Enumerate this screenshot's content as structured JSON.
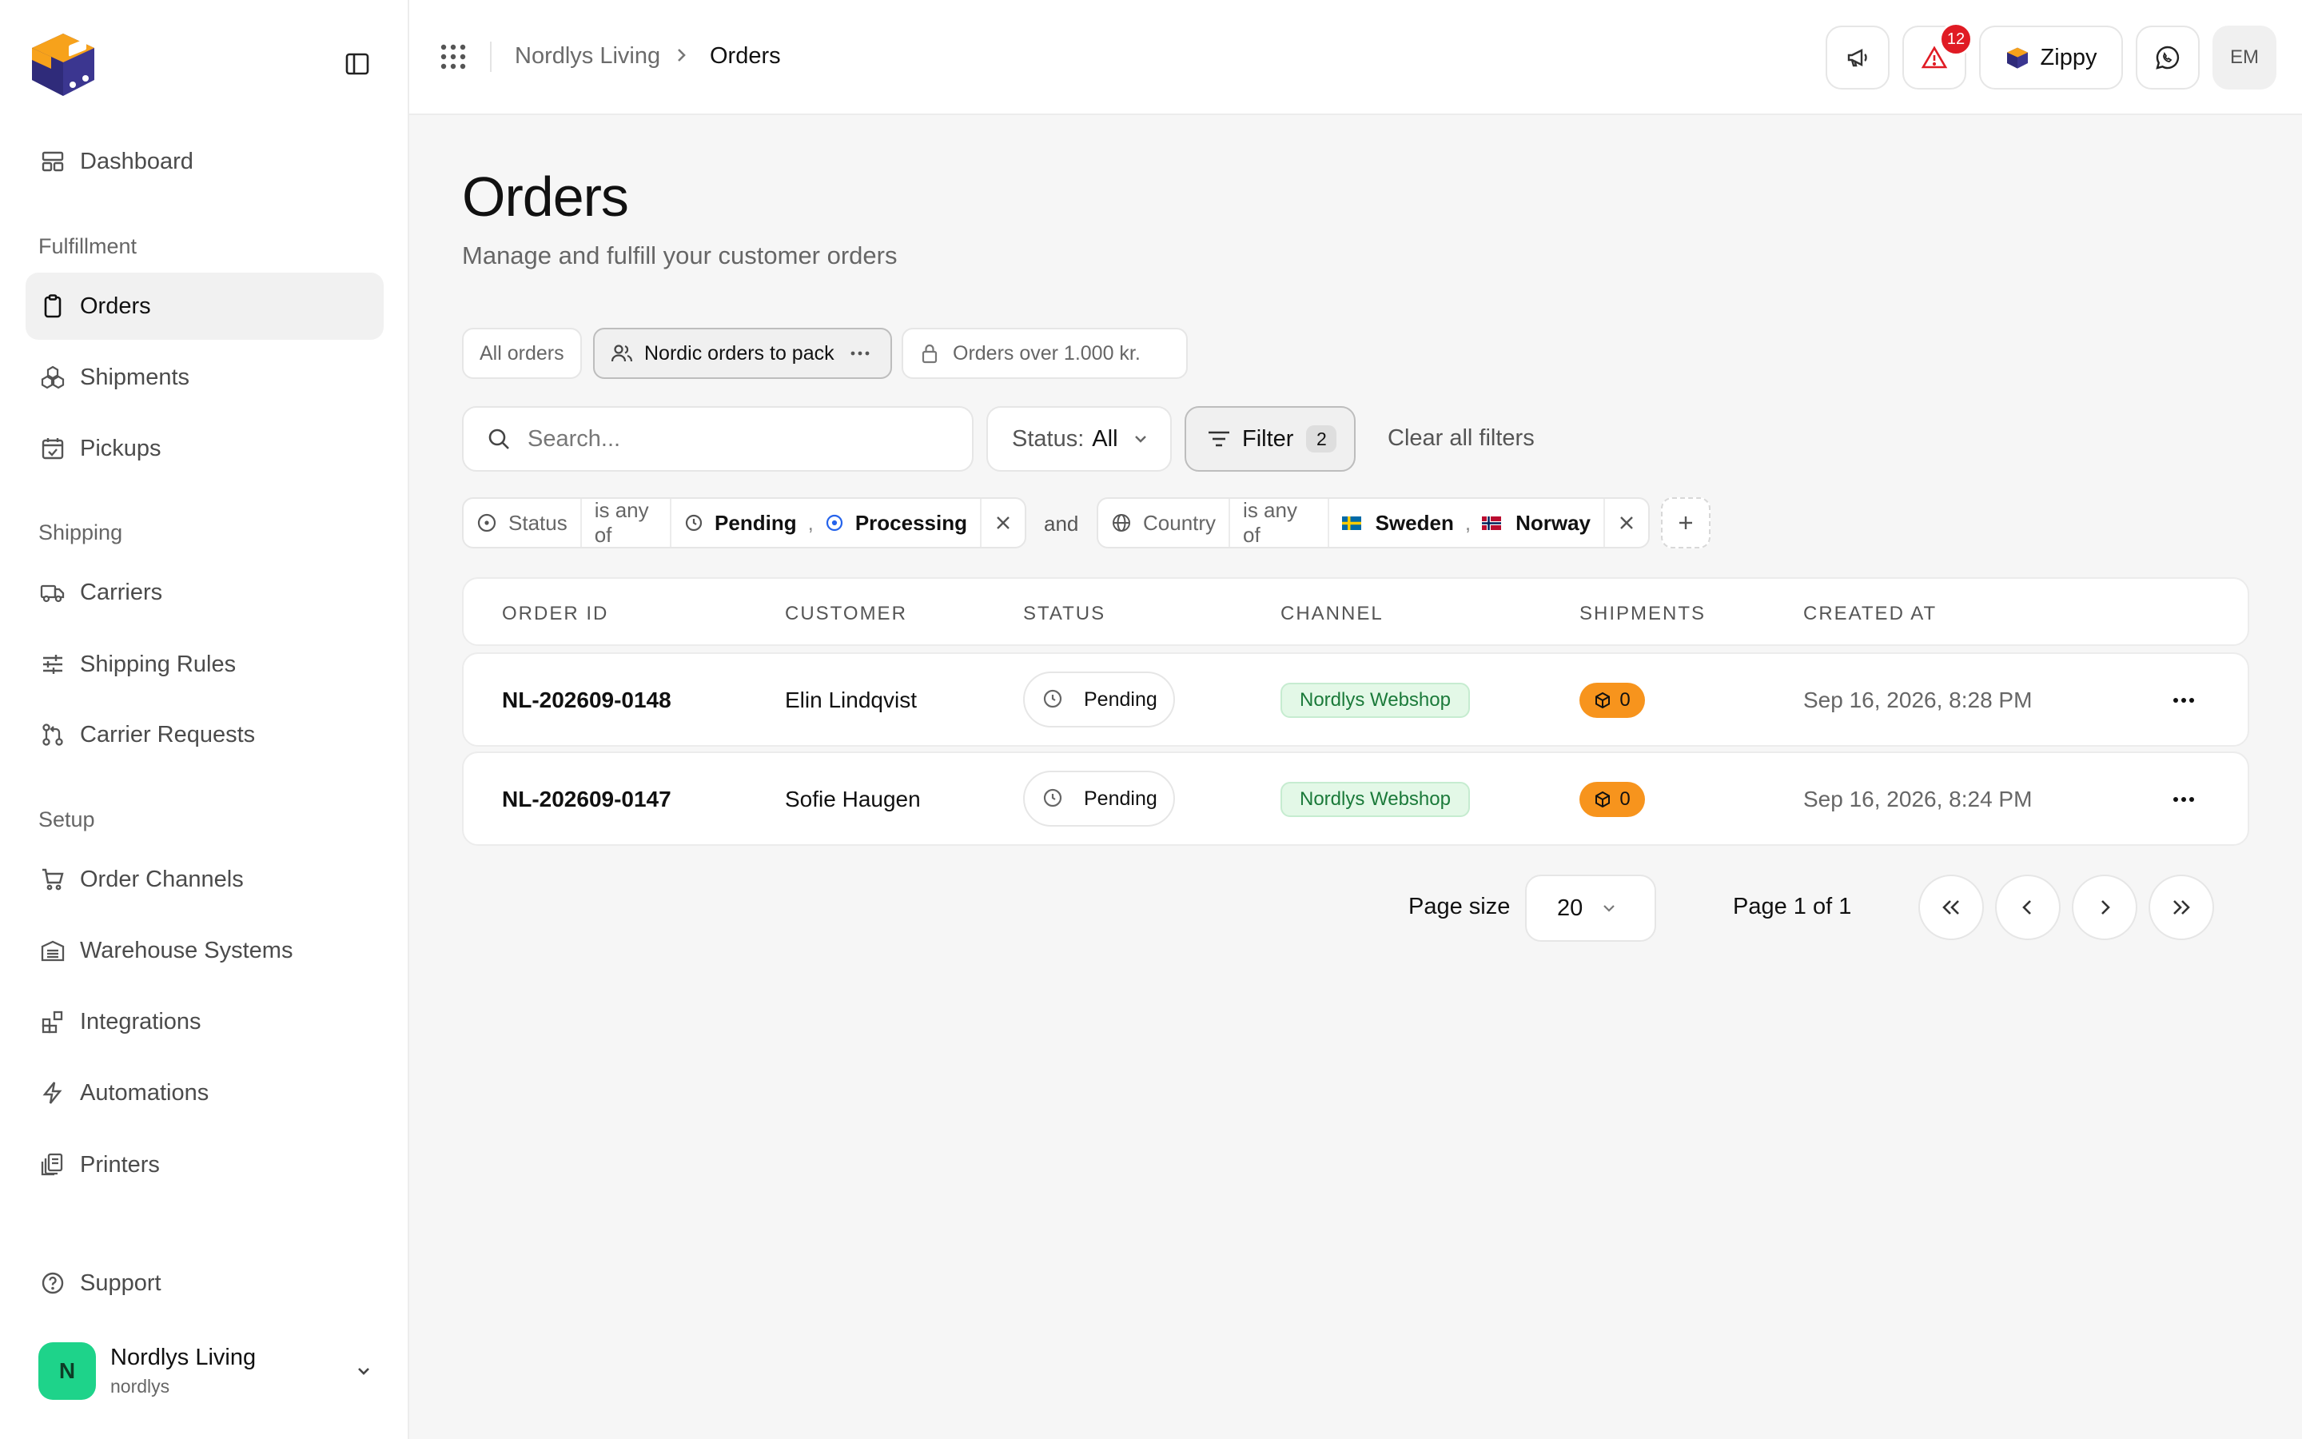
{
  "sidebar": {
    "brand_icon": "box-truck-logo-icon",
    "items": {
      "dashboard": "Dashboard",
      "orders": "Orders",
      "shipments": "Shipments",
      "pickups": "Pickups",
      "carriers": "Carriers",
      "shipping_rules": "Shipping Rules",
      "carrier_requests": "Carrier Requests",
      "order_channels": "Order Channels",
      "warehouse_systems": "Warehouse Systems",
      "integrations": "Integrations",
      "automations": "Automations",
      "printers": "Printers",
      "support": "Support"
    },
    "sections": {
      "fulfillment": "Fulfillment",
      "shipping": "Shipping",
      "setup": "Setup"
    },
    "org": {
      "initial": "N",
      "name": "Nordlys Living",
      "slug": "nordlys"
    }
  },
  "topbar": {
    "breadcrumb_home": "Nordlys Living",
    "breadcrumb_current": "Orders",
    "alert_count": "12",
    "assistant_label": "Zippy",
    "user_initials": "EM"
  },
  "page": {
    "title": "Orders",
    "subtitle": "Manage and fulfill your customer orders"
  },
  "views": {
    "all": "All orders",
    "nordic": "Nordic orders to pack",
    "over": "Orders over 1.000 kr."
  },
  "toolbar": {
    "search_placeholder": "Search...",
    "status_label": "Status:",
    "status_value": "All",
    "filter_label": "Filter",
    "filter_count": "2",
    "clear_label": "Clear all filters"
  },
  "filters": {
    "status": {
      "field": "Status",
      "op": "is any of",
      "values": [
        "Pending",
        "Processing"
      ]
    },
    "joiner": "and",
    "country": {
      "field": "Country",
      "op": "is any of",
      "values": [
        "Sweden",
        "Norway"
      ]
    },
    "separator": ","
  },
  "table": {
    "columns": [
      "ORDER ID",
      "CUSTOMER",
      "STATUS",
      "CHANNEL",
      "SHIPMENTS",
      "CREATED AT"
    ],
    "rows": [
      {
        "order_id": "NL-202609-0148",
        "customer": "Elin Lindqvist",
        "status": "Pending",
        "channel": "Nordlys Webshop",
        "shipments": "0",
        "created_at": "Sep 16, 2026, 8:28 PM"
      },
      {
        "order_id": "NL-202609-0147",
        "customer": "Sofie Haugen",
        "status": "Pending",
        "channel": "Nordlys Webshop",
        "shipments": "0",
        "created_at": "Sep 16, 2026, 8:24 PM"
      }
    ]
  },
  "pagination": {
    "page_size_label": "Page size",
    "page_size": "20",
    "page_info": "Page 1 of 1"
  },
  "colors": {
    "accent_orange": "#f7941d",
    "brand_navy": "#2b2a6b",
    "channel_green": "#e3f8e7",
    "alert_red": "#e01b24",
    "org_green": "#1ed38a"
  }
}
